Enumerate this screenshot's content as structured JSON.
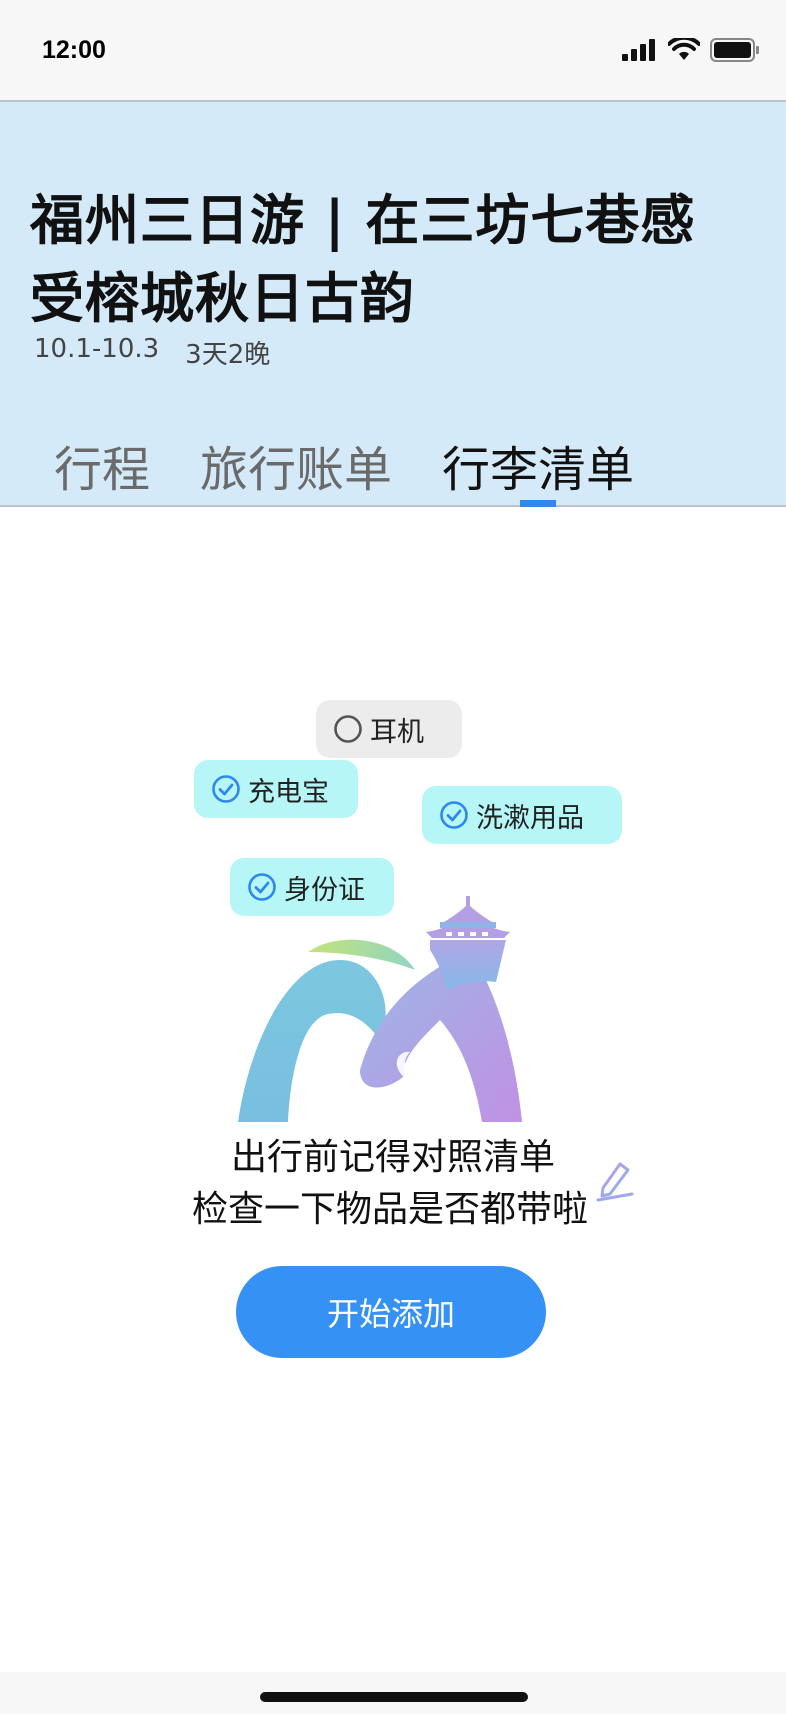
{
  "status_bar": {
    "time": "12:00"
  },
  "header": {
    "title": "福州三日游 | 在三坊七巷感受榕城秋日古韵",
    "dates": "10.1-10.3",
    "duration": "3天2晚"
  },
  "tabs": [
    {
      "label": "行程",
      "active": false
    },
    {
      "label": "旅行账单",
      "active": false
    },
    {
      "label": "行李清单",
      "active": true
    }
  ],
  "packing_examples": [
    {
      "label": "耳机",
      "checked": false
    },
    {
      "label": "充电宝",
      "checked": true
    },
    {
      "label": "洗漱用品",
      "checked": true
    },
    {
      "label": "身份证",
      "checked": true
    }
  ],
  "empty_state": {
    "line1": "出行前记得对照清单",
    "line2": "检查一下物品是否都带啦",
    "button_label": "开始添加"
  },
  "colors": {
    "header_bg": "#d4eaf8",
    "accent": "#3591f3",
    "chip_checked_bg": "#b7f6f6",
    "chip_unchecked_bg": "#ececec"
  }
}
